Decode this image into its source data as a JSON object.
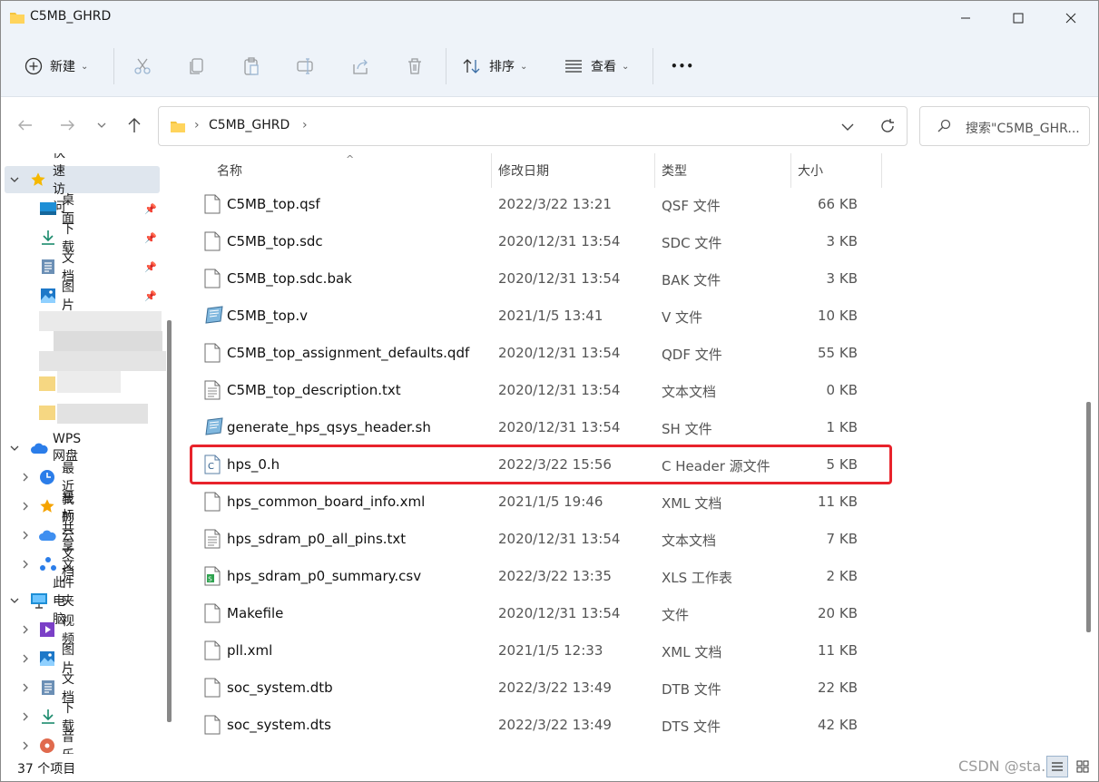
{
  "window": {
    "title": "C5MB_GHRD",
    "minimize_icon": "minimize-icon",
    "maximize_icon": "maximize-icon",
    "close_icon": "close-icon"
  },
  "toolbar": {
    "new_label": "新建",
    "sort_label": "排序",
    "view_label": "查看",
    "more_label": "•••"
  },
  "address": {
    "crumb": "C5MB_GHRD",
    "search_placeholder": "搜索\"C5MB_GHR..."
  },
  "sidebar": {
    "quick_access": "快速访问",
    "quick_items": [
      {
        "label": "桌面",
        "icon": "desktop-icon"
      },
      {
        "label": "下载",
        "icon": "download-icon"
      },
      {
        "label": "文档",
        "icon": "document-icon"
      },
      {
        "label": "图片",
        "icon": "picture-icon"
      }
    ],
    "wps": "WPS网盘",
    "wps_items": [
      {
        "label": "最近",
        "icon": "clock-icon"
      },
      {
        "label": "星标",
        "icon": "star-icon"
      },
      {
        "label": "我的云文档",
        "icon": "cloud-icon"
      },
      {
        "label": "共享文件夹",
        "icon": "share-icon"
      }
    ],
    "this_pc": "此电脑",
    "pc_items": [
      {
        "label": "视频",
        "icon": "video-icon"
      },
      {
        "label": "图片",
        "icon": "picture-icon"
      },
      {
        "label": "文档",
        "icon": "document-icon"
      },
      {
        "label": "下载",
        "icon": "download-icon"
      },
      {
        "label": "音乐",
        "icon": "music-icon"
      }
    ]
  },
  "columns": {
    "name": "名称",
    "date": "修改日期",
    "type": "类型",
    "size": "大小"
  },
  "files": [
    {
      "name": "C5MB_top.qsf",
      "date": "2022/3/22 13:21",
      "type": "QSF 文件",
      "size": "66 KB",
      "icon": "file-icon"
    },
    {
      "name": "C5MB_top.sdc",
      "date": "2020/12/31 13:54",
      "type": "SDC 文件",
      "size": "3 KB",
      "icon": "file-icon"
    },
    {
      "name": "C5MB_top.sdc.bak",
      "date": "2020/12/31 13:54",
      "type": "BAK 文件",
      "size": "3 KB",
      "icon": "file-icon"
    },
    {
      "name": "C5MB_top.v",
      "date": "2021/1/5 13:41",
      "type": "V 文件",
      "size": "10 KB",
      "icon": "script-icon"
    },
    {
      "name": "C5MB_top_assignment_defaults.qdf",
      "date": "2020/12/31 13:54",
      "type": "QDF 文件",
      "size": "55 KB",
      "icon": "file-icon"
    },
    {
      "name": "C5MB_top_description.txt",
      "date": "2020/12/31 13:54",
      "type": "文本文档",
      "size": "0 KB",
      "icon": "text-file-icon"
    },
    {
      "name": "generate_hps_qsys_header.sh",
      "date": "2020/12/31 13:54",
      "type": "SH 文件",
      "size": "1 KB",
      "icon": "script-icon"
    },
    {
      "name": "hps_0.h",
      "date": "2022/3/22 15:56",
      "type": "C Header 源文件",
      "size": "5 KB",
      "icon": "c-header-icon"
    },
    {
      "name": "hps_common_board_info.xml",
      "date": "2021/1/5 19:46",
      "type": "XML 文档",
      "size": "11 KB",
      "icon": "file-icon"
    },
    {
      "name": "hps_sdram_p0_all_pins.txt",
      "date": "2020/12/31 13:54",
      "type": "文本文档",
      "size": "7 KB",
      "icon": "text-file-icon"
    },
    {
      "name": "hps_sdram_p0_summary.csv",
      "date": "2022/3/22 13:35",
      "type": "XLS 工作表",
      "size": "2 KB",
      "icon": "spreadsheet-icon"
    },
    {
      "name": "Makefile",
      "date": "2020/12/31 13:54",
      "type": "文件",
      "size": "20 KB",
      "icon": "file-icon"
    },
    {
      "name": "pll.xml",
      "date": "2021/1/5 12:33",
      "type": "XML 文档",
      "size": "11 KB",
      "icon": "file-icon"
    },
    {
      "name": "soc_system.dtb",
      "date": "2022/3/22 13:49",
      "type": "DTB 文件",
      "size": "22 KB",
      "icon": "file-icon"
    },
    {
      "name": "soc_system.dts",
      "date": "2022/3/22 13:49",
      "type": "DTS 文件",
      "size": "42 KB",
      "icon": "file-icon"
    }
  ],
  "status": {
    "count": "37 个项目",
    "watermark": "CSDN @sta..."
  },
  "colors": {
    "titlebar_bg": "#eef3f9",
    "highlight": "#e8232b",
    "selection_bg": "#dfe6ee"
  }
}
